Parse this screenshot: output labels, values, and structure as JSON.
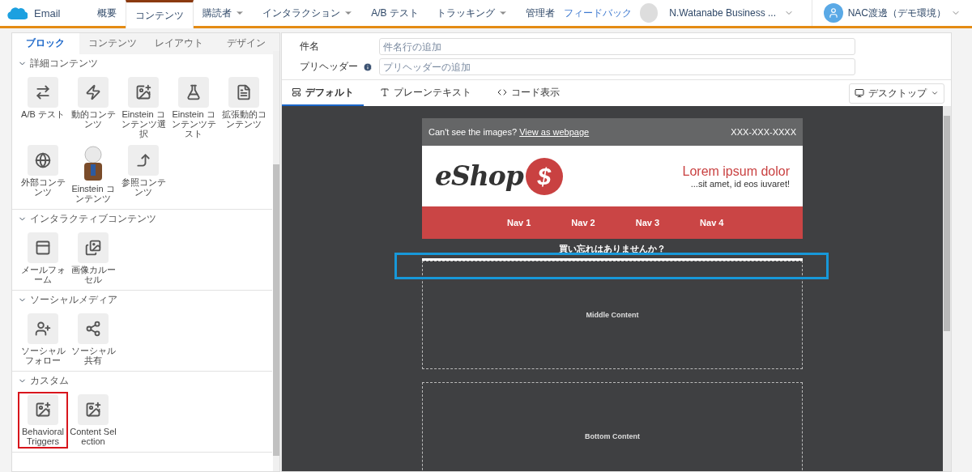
{
  "app": {
    "name": "Email"
  },
  "nav_tabs": [
    {
      "label": "概要",
      "selected": false,
      "dropdown": false
    },
    {
      "label": "コンテンツ",
      "selected": true,
      "dropdown": false
    },
    {
      "label": "購読者",
      "selected": false,
      "dropdown": true
    },
    {
      "label": "インタラクション",
      "selected": false,
      "dropdown": true
    },
    {
      "label": "A/B テスト",
      "selected": false,
      "dropdown": false
    },
    {
      "label": "トラッキング",
      "selected": false,
      "dropdown": true
    },
    {
      "label": "管理者",
      "selected": false,
      "dropdown": false
    }
  ],
  "feedback": "フィードバック",
  "business_unit": "N.Watanabe Business ...",
  "user": "NAC渡邊（デモ環境）",
  "panel_tabs": [
    {
      "label": "ブロック",
      "selected": true
    },
    {
      "label": "コンテンツ",
      "selected": false
    },
    {
      "label": "レイアウト",
      "selected": false
    },
    {
      "label": "デザイン",
      "selected": false
    }
  ],
  "sections": [
    {
      "title": "詳細コンテンツ",
      "expanded": true,
      "blocks": [
        {
          "label": "A/B テスト",
          "kind": "ab",
          "highlighted": false
        },
        {
          "label": "動的コンテンツ",
          "kind": "bolt",
          "highlighted": false
        },
        {
          "label": "Einstein コンテンツ選択",
          "kind": "image-person",
          "highlighted": false
        },
        {
          "label": "Einstein コンテンツテスト",
          "kind": "flask",
          "highlighted": false
        },
        {
          "label": "拡張動的コンテンツ",
          "kind": "doc-plus",
          "highlighted": false
        },
        {
          "label": "外部コンテンツ",
          "kind": "globe",
          "highlighted": false
        },
        {
          "label": "Einstein コンテンツ",
          "kind": "mascot",
          "highlighted": false
        },
        {
          "label": "参照コンテンツ",
          "kind": "reference",
          "highlighted": false
        }
      ]
    },
    {
      "title": "インタラクティブコンテンツ",
      "expanded": true,
      "blocks": [
        {
          "label": "メールフォーム",
          "kind": "form",
          "highlighted": false
        },
        {
          "label": "画像カルーセル",
          "kind": "carousel",
          "highlighted": false
        }
      ]
    },
    {
      "title": "ソーシャルメディア",
      "expanded": true,
      "blocks": [
        {
          "label": "ソーシャルフォロー",
          "kind": "follow",
          "highlighted": false
        },
        {
          "label": "ソーシャル共有",
          "kind": "share",
          "highlighted": false
        }
      ]
    },
    {
      "title": "カスタム",
      "expanded": true,
      "blocks": [
        {
          "label": "Behavioral Triggers",
          "kind": "image-bolt",
          "highlighted": true
        },
        {
          "label": "Content Selection",
          "kind": "image-person",
          "highlighted": false
        }
      ]
    }
  ],
  "fields": [
    {
      "label": "件名",
      "placeholder": "件名行の追加",
      "info": false
    },
    {
      "label": "プリヘッダー",
      "placeholder": "プリヘッダーの追加",
      "info": true
    }
  ],
  "editor_tabs": [
    {
      "label": "デフォルト",
      "kind": "layout",
      "selected": true
    },
    {
      "label": "プレーンテキスト",
      "kind": "text",
      "selected": false
    },
    {
      "label": "コード表示",
      "kind": "code",
      "selected": false
    }
  ],
  "device": "デスクトップ",
  "email": {
    "preheader": "Can't see the images?",
    "web_link": "View as webpage",
    "phone": "XXX-XXX-XXXX",
    "logo_word": "eShop",
    "logo_mark": "$",
    "headline": "Lorem ipsum dolor",
    "tagline": "...sit amet, id eos iuvaret!",
    "nav": [
      "Nav 1",
      "Nav 2",
      "Nav 3",
      "Nav 4"
    ],
    "heading": "買い忘れはありませんか？",
    "regions": [
      "Middle Content",
      "Bottom Content"
    ]
  }
}
